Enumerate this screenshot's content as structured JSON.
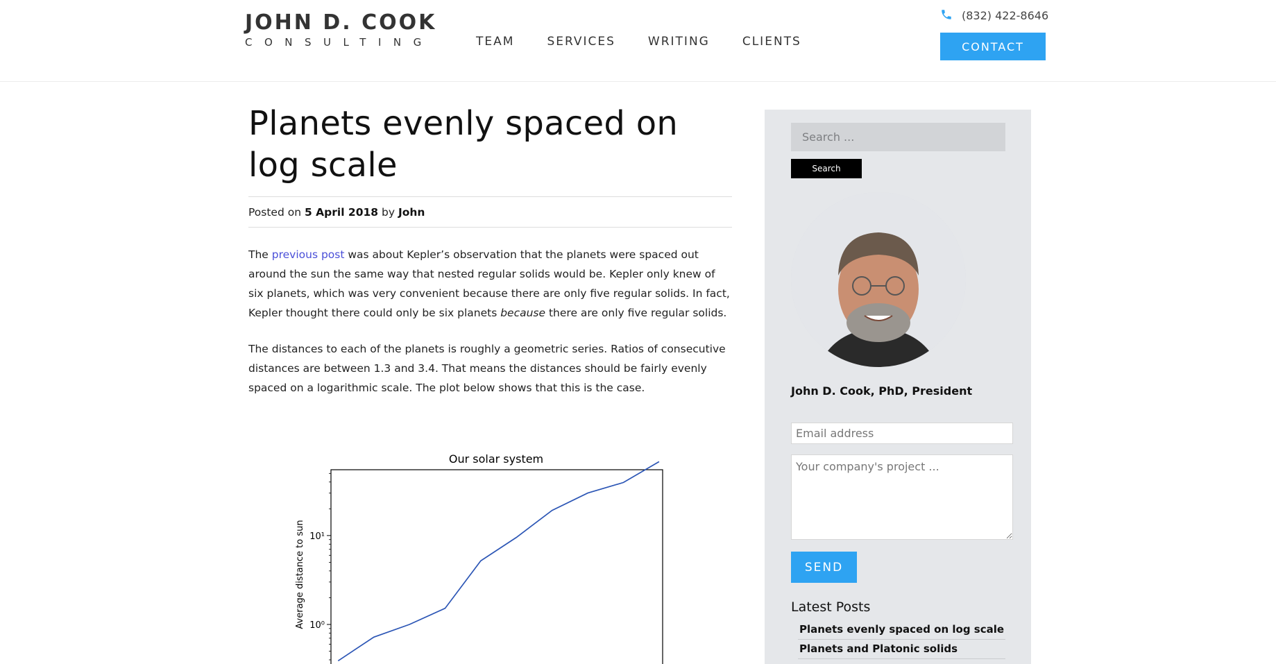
{
  "header": {
    "logo_title": "JOHN D. COOK",
    "logo_subtitle": "CONSULTING",
    "nav": [
      "TEAM",
      "SERVICES",
      "WRITING",
      "CLIENTS"
    ],
    "phone": "(832) 422-8646",
    "contact_label": "CONTACT",
    "phone_icon": "phone-icon",
    "accent_color": "#2ea3f2"
  },
  "post": {
    "title": "Planets evenly spaced on log scale",
    "meta_prefix": "Posted on",
    "date": "5 April 2018",
    "meta_by": "by",
    "author": "John",
    "p1_before_link": "The ",
    "p1_link": "previous post",
    "p1_after_link": " was about Kepler’s observation that the planets were spaced out around the sun the same way that nested regular solids would be. Kepler only knew of six planets, which was very convenient because there are only five regular solids. In fact, Kepler thought there could only be six planets ",
    "p1_emph": "because",
    "p1_end": " there are only five regular solids.",
    "p2": "The distances to each of the planets is roughly a geometric series. Ratios of consecutive distances are between 1.3 and 3.4. That means the distances should be fairly evenly spaced on a logarithmic scale. The plot below shows that this is the case."
  },
  "chart_data": {
    "type": "line",
    "title": "Our solar system",
    "xlabel": "",
    "ylabel": "Average distance to sun",
    "yscale": "log",
    "ytick_labels": [
      "10⁰",
      "10¹"
    ],
    "ylim": [
      0.3,
      55
    ],
    "x": [
      1,
      2,
      3,
      4,
      5,
      6,
      7,
      8,
      9,
      10
    ],
    "series": [
      {
        "values": [
          0.39,
          0.72,
          1.0,
          1.52,
          5.2,
          9.54,
          19.2,
          30.06,
          39.5,
          67.7
        ],
        "color": "#2b55b5"
      }
    ],
    "grid": false
  },
  "sidebar": {
    "search_placeholder": "Search ...",
    "search_button": "Search",
    "bio_name": "John D. Cook, PhD, President",
    "email_placeholder": "Email address",
    "project_placeholder": "Your company's project ...",
    "send_label": "SEND",
    "latest_title": "Latest Posts",
    "latest_posts": [
      "Planets evenly spaced on log scale",
      "Planets and Platonic solids"
    ]
  }
}
